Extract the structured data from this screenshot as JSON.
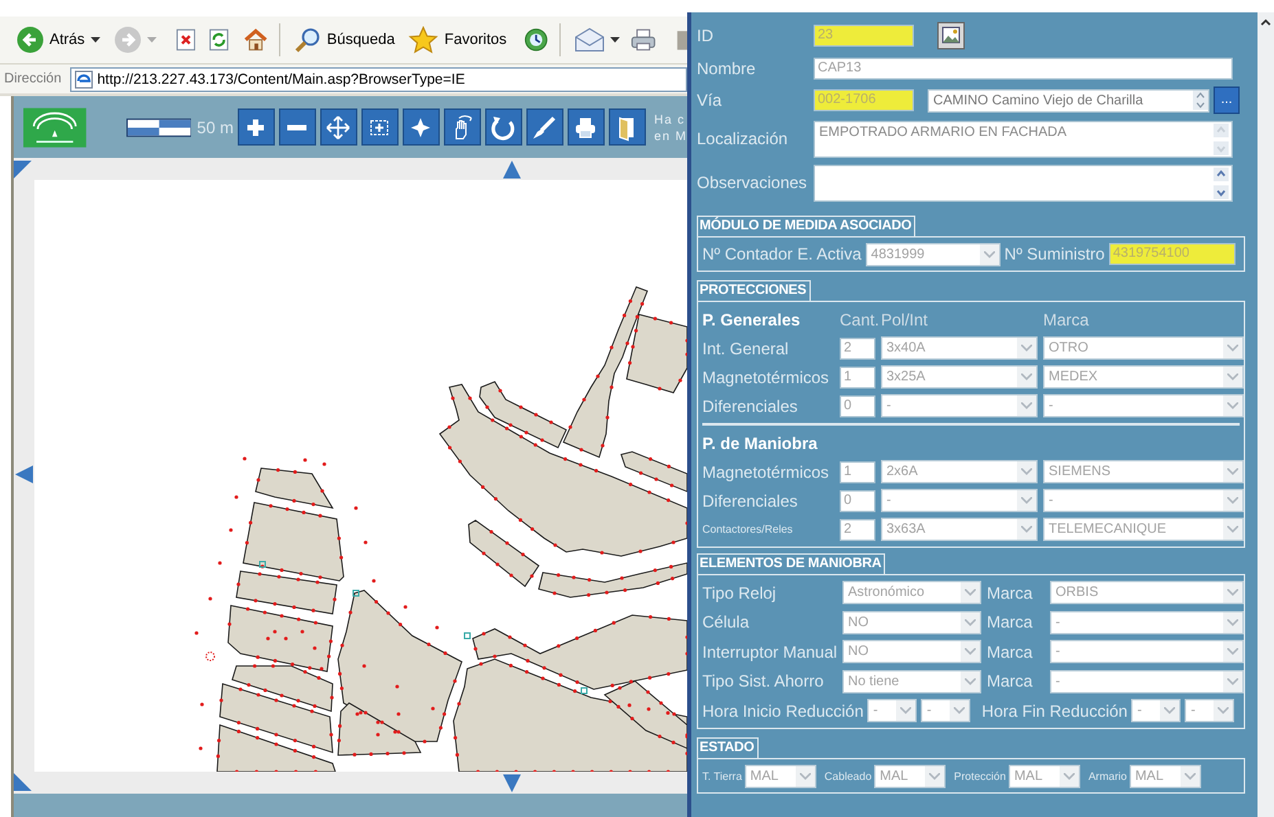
{
  "browser": {
    "back_label": "Atrás",
    "search_label": "Búsqueda",
    "favorites_label": "Favoritos",
    "address_label": "Dirección",
    "url": "http://213.227.43.173/Content/Main.asp?BrowserType=IE"
  },
  "map_toolbar": {
    "scale_label": "50 m",
    "hint_lines": [
      "Ha c",
      "en M"
    ]
  },
  "form": {
    "id": {
      "label": "ID",
      "value": "23",
      "highlighted": true
    },
    "nombre": {
      "label": "Nombre",
      "value": "CAP13",
      "highlighted": false
    },
    "via": {
      "label": "Vía",
      "code": "002-1706",
      "code_highlighted": true,
      "name": "CAMINO Camino Viejo de Charilla",
      "browse_label": "..."
    },
    "localizacion": {
      "label": "Localización",
      "value": "EMPOTRADO ARMARIO EN FACHADA"
    },
    "observaciones": {
      "label": "Observaciones"
    },
    "modulo": {
      "title": "MÓDULO DE MEDIDA ASOCIADO",
      "contador_label": "Nº Contador E. Activa",
      "contador_value": "4831999",
      "suministro_label": "Nº Suministro",
      "suministro_value": "4319754100",
      "suministro_highlighted": true
    },
    "protecciones": {
      "title": "PROTECCIONES",
      "groups": [
        {
          "title": "P. Generales",
          "columns": [
            "Cant.",
            "Pol/Int",
            "Marca"
          ],
          "rows": [
            {
              "label": "Int. General",
              "cant": "2",
              "pol": "3x40A",
              "marca": "OTRO",
              "compact": false
            },
            {
              "label": "Magnetotérmicos",
              "cant": "1",
              "pol": "3x25A",
              "marca": "MEDEX",
              "compact": false
            },
            {
              "label": "Diferenciales",
              "cant": "0",
              "pol": "-",
              "marca": "-",
              "compact": false
            }
          ]
        },
        {
          "title": "P. de Maniobra",
          "rows": [
            {
              "label": "Magnetotérmicos",
              "cant": "1",
              "pol": "2x6A",
              "marca": "SIEMENS",
              "compact": false
            },
            {
              "label": "Diferenciales",
              "cant": "0",
              "pol": "-",
              "marca": "-",
              "compact": false
            },
            {
              "label": "Contactores/Reles",
              "cant": "2",
              "pol": "3x63A",
              "marca": "TELEMECANIQUE",
              "compact": true
            }
          ]
        }
      ]
    },
    "elementos": {
      "title": "ELEMENTOS DE MANIOBRA",
      "rows": [
        {
          "label": "Tipo Reloj",
          "value": "Astronómico",
          "marca_label": "Marca",
          "marca": "ORBIS"
        },
        {
          "label": "Célula",
          "value": "NO",
          "marca_label": "Marca",
          "marca": "-"
        },
        {
          "label": "Interruptor Manual",
          "value": "NO",
          "marca_label": "Marca",
          "marca": "-"
        },
        {
          "label": "Tipo Sist. Ahorro",
          "value": "No tiene",
          "marca_label": "Marca",
          "marca": "-"
        }
      ],
      "hora_inicio_label": "Hora Inicio Reducción",
      "hora_inicio": [
        "-",
        "-"
      ],
      "hora_fin_label": "Hora Fin Reducción",
      "hora_fin": [
        "-",
        "-"
      ]
    },
    "estado": {
      "title": "ESTADO",
      "items": [
        {
          "label": "T. Tierra",
          "value": "MAL"
        },
        {
          "label": "Cableado",
          "value": "MAL"
        },
        {
          "label": "Protección",
          "value": "MAL"
        },
        {
          "label": "Armario",
          "value": "MAL"
        }
      ]
    }
  }
}
